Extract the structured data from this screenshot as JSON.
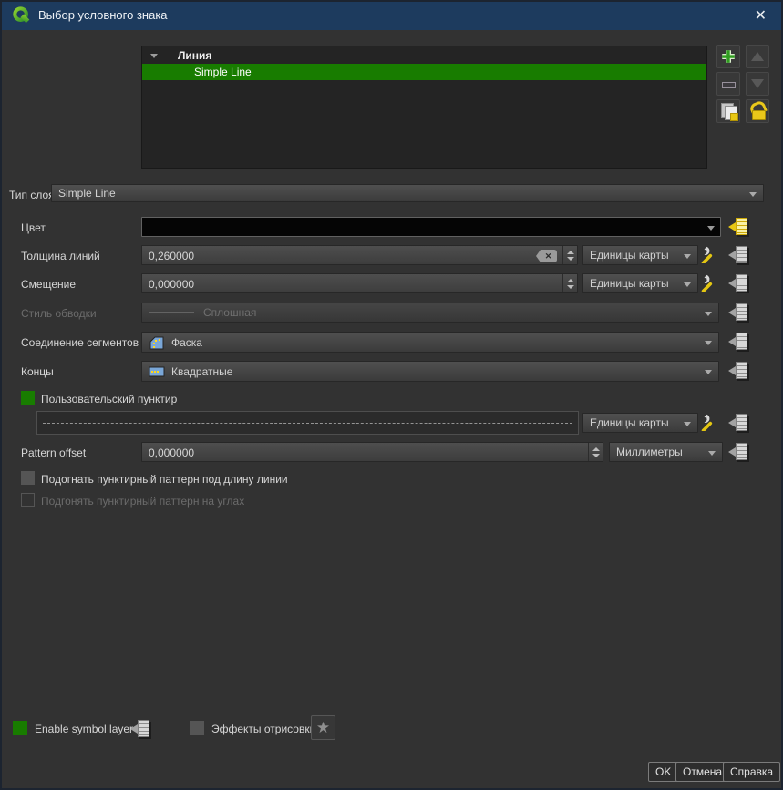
{
  "window": {
    "title": "Выбор условного знака"
  },
  "icons": {
    "close": "✕",
    "star": "★",
    "clear": "✕"
  },
  "symbol_tree": {
    "group": "Линия",
    "items": [
      {
        "label": "Simple Line",
        "selected": true
      }
    ]
  },
  "layer_type": {
    "label": "Тип слоя",
    "value": "Simple Line"
  },
  "form": {
    "color": {
      "label": "Цвет",
      "value_color": "#000000"
    },
    "line_width": {
      "label": "Толщина линий",
      "value": "0,260000",
      "unit": "Единицы карты"
    },
    "offset": {
      "label": "Смещение",
      "value": "0,000000",
      "unit": "Единицы карты"
    },
    "stroke_style": {
      "label": "Стиль обводки",
      "value": "Сплошная",
      "enabled": false
    },
    "join_style": {
      "label": "Соединение сегментов",
      "value": "Фаска"
    },
    "cap_style": {
      "label": "Концы",
      "value": "Квадратные"
    },
    "custom_dash": {
      "label": "Пользовательский пунктир",
      "checked": true,
      "unit": "Единицы карты"
    },
    "pattern_offset": {
      "label": "Pattern offset",
      "value": "0,000000",
      "unit": "Миллиметры"
    },
    "align_dash": {
      "label": "Подогнать пунктирный паттерн под длину линии",
      "checked": false
    },
    "tweak_dash": {
      "label": "Подгонять пунктирный паттерн на углах",
      "checked": false,
      "enabled": false
    }
  },
  "footer": {
    "enable_symbol_layer": {
      "label": "Enable symbol layer",
      "checked": true
    },
    "draw_effects": {
      "label": "Эффекты отрисовки",
      "checked": false
    },
    "buttons": {
      "ok": "OK",
      "cancel": "Отмена",
      "help": "Справка"
    }
  },
  "colors": {
    "titlebar": "#1d3b5e",
    "background": "#323232",
    "selection_green": "#187c00",
    "accent_yellow": "#e8c713"
  }
}
